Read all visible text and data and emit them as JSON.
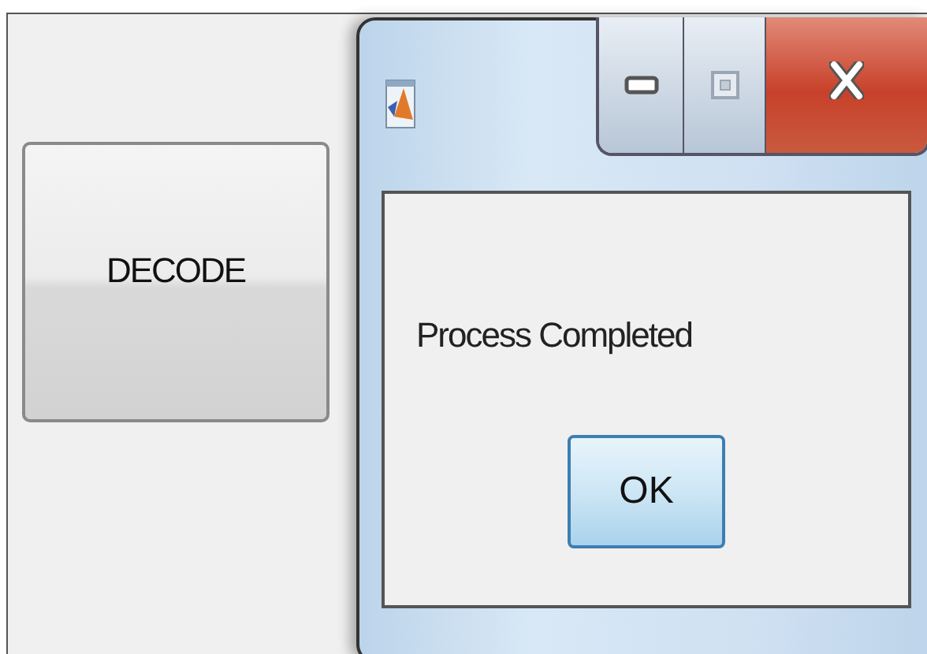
{
  "app": {
    "button": {
      "label": "DECODE"
    }
  },
  "dialog": {
    "message": "Process Completed",
    "button": {
      "label": "OK",
      "focused": true
    }
  }
}
